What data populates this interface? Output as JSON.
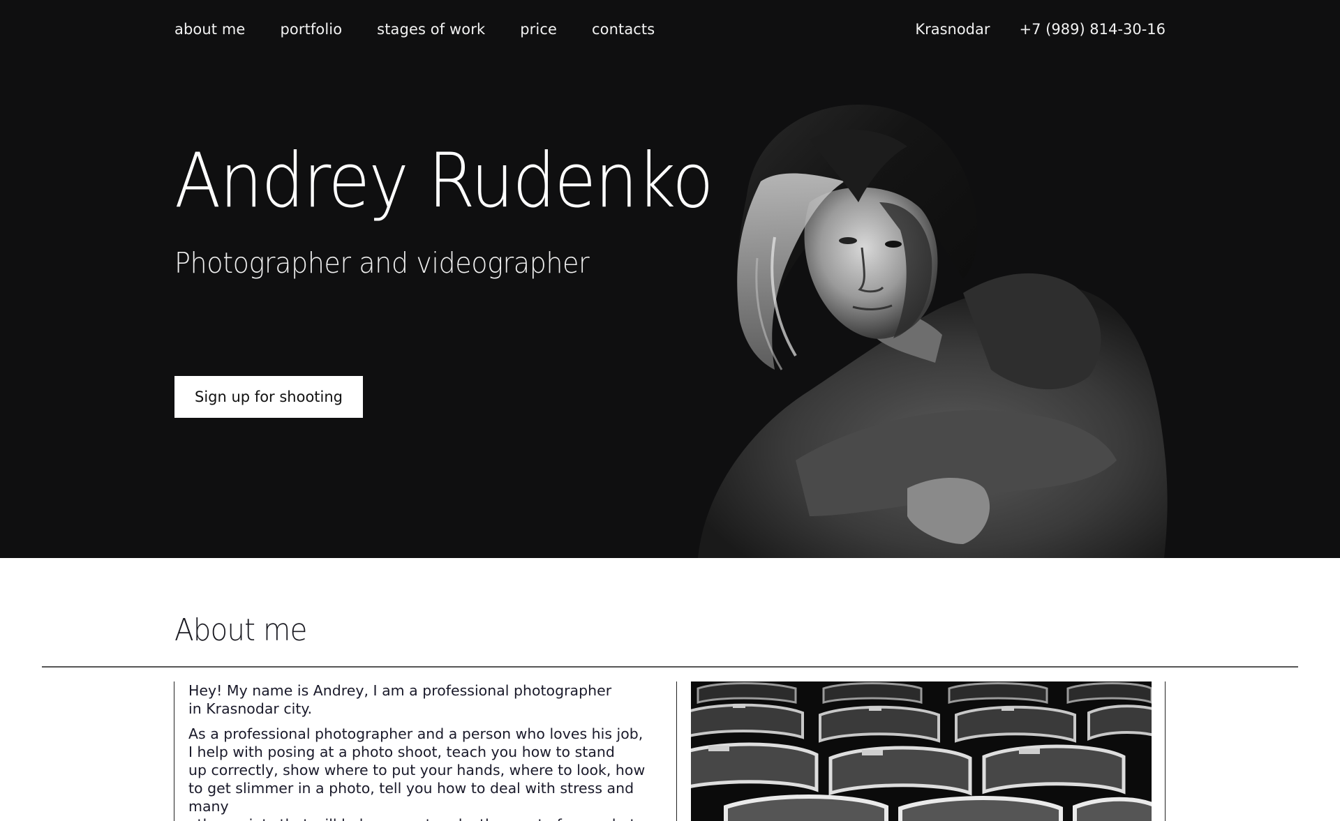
{
  "nav": {
    "items": [
      {
        "label": "about me"
      },
      {
        "label": "portfolio"
      },
      {
        "label": "stages of work"
      },
      {
        "label": "price"
      },
      {
        "label": "contacts"
      }
    ]
  },
  "header_contacts": {
    "city": "Krasnodar",
    "phone": "+7 (989) 814-30-16"
  },
  "hero": {
    "title": "Andrey Rudenko",
    "subtitle": "Photographer and videographer",
    "cta_label": "Sign up for shooting"
  },
  "about": {
    "heading": "About me",
    "paragraph_1": "Hey! My name is Andrey, I am a professional photographer\nin Krasnodar city.",
    "paragraph_2": "As a professional photographer and a person who loves his job,\nI help with posing at a photo shoot, teach you how to stand\nup correctly, show where to put your hands, where to look, how\nto get slimmer in a photo, tell you how to deal with stress and many\nother points that will help you get make the most of your photo\nsession."
  },
  "colors": {
    "hero_bg": "#0f0f10",
    "text_light": "#f2f2f2",
    "text_dark": "#1a1a2a",
    "cta_bg": "#ffffff"
  }
}
